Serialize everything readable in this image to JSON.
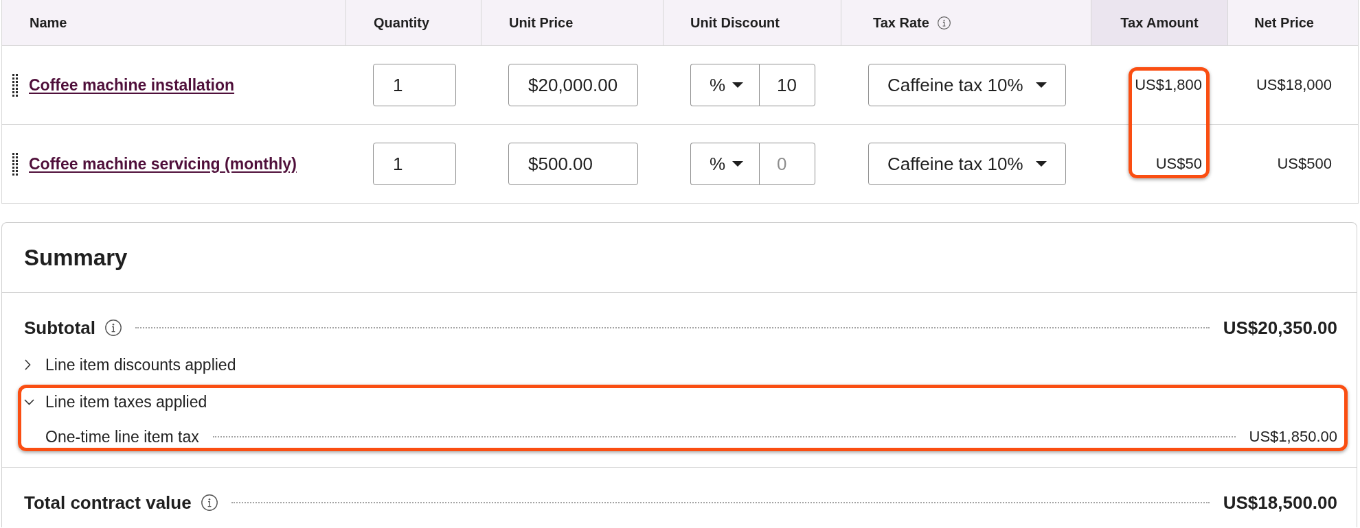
{
  "table": {
    "columns": [
      {
        "label": "Name",
        "info": false,
        "active": false,
        "callout": false
      },
      {
        "label": "Quantity",
        "info": false,
        "active": false,
        "callout": false
      },
      {
        "label": "Unit Price",
        "info": false,
        "active": false,
        "callout": false
      },
      {
        "label": "Unit Discount",
        "info": false,
        "active": false,
        "callout": false
      },
      {
        "label": "Tax Rate",
        "info": true,
        "active": false,
        "callout": false
      },
      {
        "label": "Tax Amount",
        "info": false,
        "active": true,
        "callout": true
      },
      {
        "label": "Net Price",
        "info": false,
        "active": false,
        "callout": false
      }
    ],
    "rows": [
      {
        "name": "Coffee machine installation",
        "quantity": "1",
        "unit_price": "$20,000.00",
        "discount": {
          "type": "%",
          "value": "10"
        },
        "tax_rate": "Caffeine tax 10%",
        "tax_amount": "US$1,800",
        "net_price": "US$18,000"
      },
      {
        "name": "Coffee machine servicing (monthly)",
        "quantity": "1",
        "unit_price": "$500.00",
        "discount": {
          "type": "%",
          "placeholder": "0"
        },
        "tax_rate": "Caffeine tax 10%",
        "tax_amount": "US$50",
        "net_price": "US$500"
      }
    ]
  },
  "summary": {
    "title": "Summary",
    "subtotal": {
      "label": "Subtotal",
      "info": true,
      "value": "US$20,350.00"
    },
    "groups": [
      {
        "label": "Line item discounts applied",
        "expanded": false,
        "callout": false
      },
      {
        "label": "Line item taxes applied",
        "expanded": true,
        "callout": true,
        "lines": [
          {
            "label": "One-time line item tax",
            "value": "US$1,850.00"
          }
        ]
      }
    ],
    "total": {
      "label": "Total contract value",
      "info": true,
      "value": "US$18,500.00"
    }
  }
}
